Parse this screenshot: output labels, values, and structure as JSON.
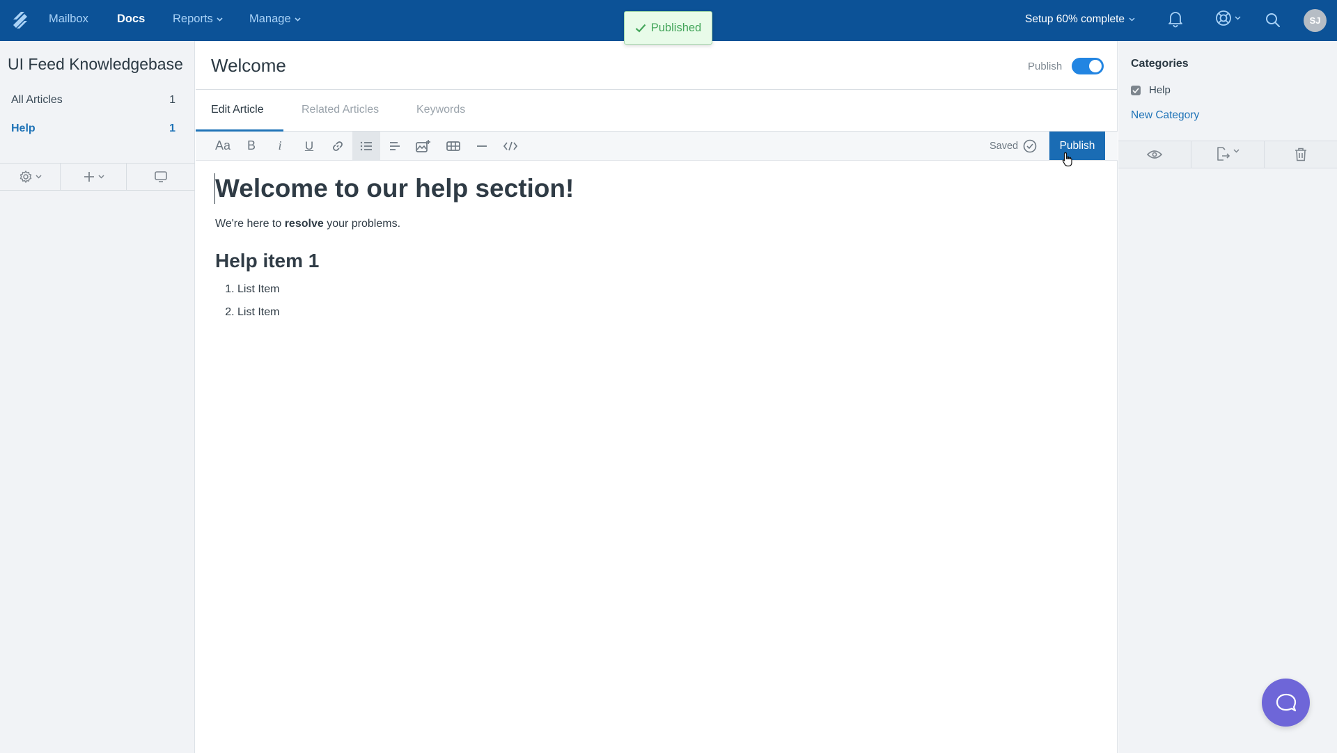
{
  "topnav": {
    "logo": "helpscout-logo-icon",
    "items": [
      {
        "label": "Mailbox",
        "active": false,
        "dropdown": false
      },
      {
        "label": "Docs",
        "active": true,
        "dropdown": false
      },
      {
        "label": "Reports",
        "active": false,
        "dropdown": true
      },
      {
        "label": "Manage",
        "active": false,
        "dropdown": true
      }
    ],
    "setup_label": "Setup 60% complete",
    "setup_progress_percent": 60,
    "avatar_initials": "SJ",
    "icons": [
      "bell-icon",
      "help-lifebuoy-icon",
      "search-icon"
    ],
    "brand_color": "#0c5297"
  },
  "toast": {
    "message": "Published",
    "icon": "check-icon"
  },
  "sidebar": {
    "title": "UI Feed Knowledgebase",
    "items": [
      {
        "label": "All Articles",
        "count": "1",
        "active": false
      },
      {
        "label": "Help",
        "count": "1",
        "active": true
      }
    ],
    "tools": [
      "gear-icon",
      "plus-icon",
      "monitor-icon"
    ]
  },
  "article": {
    "title": "Welcome",
    "publish_toggle_label": "Publish",
    "publish_toggle_on": true,
    "tabs": [
      {
        "label": "Edit Article",
        "active": true
      },
      {
        "label": "Related Articles",
        "active": false
      },
      {
        "label": "Keywords",
        "active": false
      }
    ],
    "toolbar": {
      "buttons": [
        "font-size",
        "bold",
        "italic",
        "underline",
        "link",
        "list",
        "align",
        "insert-image",
        "table",
        "horizontal-rule",
        "code"
      ],
      "active_button": "list",
      "saved_label": "Saved",
      "publish_button": "Publish"
    },
    "content": {
      "heading": "Welcome to our help section!",
      "paragraph_before": "We're here to ",
      "paragraph_bold": "resolve",
      "paragraph_after": " your problems.",
      "subheading": "Help item 1",
      "list": [
        "List Item",
        "List Item"
      ]
    }
  },
  "rightpanel": {
    "categories_title": "Categories",
    "categories": [
      {
        "label": "Help",
        "checked": true
      }
    ],
    "new_category_link": "New Category",
    "tools": [
      "eye-icon",
      "export-icon",
      "trash-icon"
    ]
  },
  "chat": {
    "icon": "chat-bubble-icon",
    "color": "#6e66d8"
  }
}
